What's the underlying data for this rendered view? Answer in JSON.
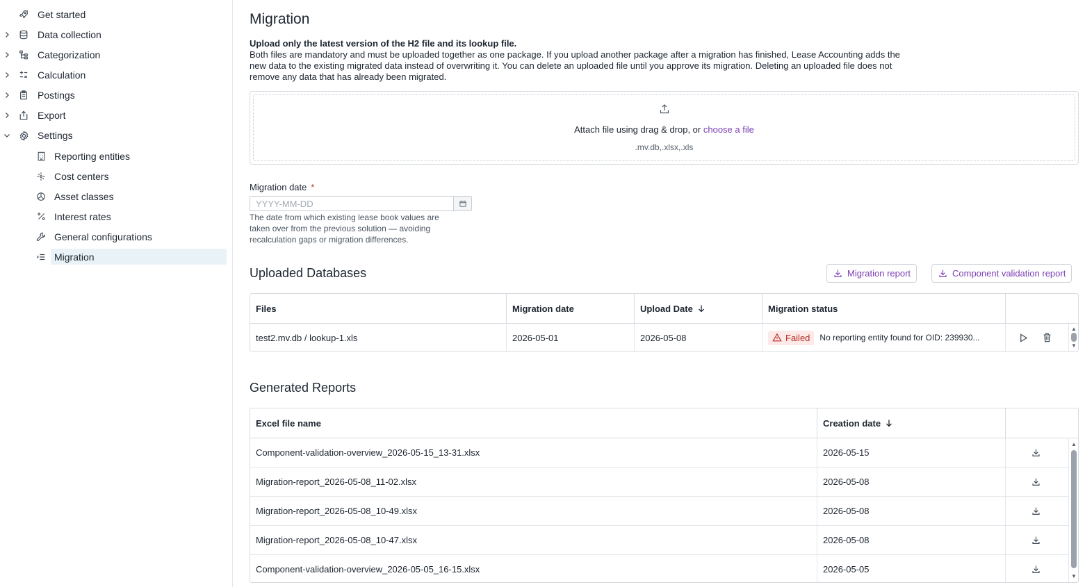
{
  "sidebar": {
    "items": [
      {
        "label": "Get started",
        "icon": "rocket-icon",
        "expandable": false
      },
      {
        "label": "Data collection",
        "icon": "database-icon",
        "expandable": true
      },
      {
        "label": "Categorization",
        "icon": "hierarchy-icon",
        "expandable": true
      },
      {
        "label": "Calculation",
        "icon": "calculator-icon",
        "expandable": true
      },
      {
        "label": "Postings",
        "icon": "clipboard-icon",
        "expandable": true
      },
      {
        "label": "Export",
        "icon": "export-icon",
        "expandable": true
      },
      {
        "label": "Settings",
        "icon": "gear-icon",
        "expandable": true,
        "expanded": true
      }
    ],
    "settings_children": [
      {
        "label": "Reporting entities",
        "icon": "building-icon"
      },
      {
        "label": "Cost centers",
        "icon": "cost-center-icon"
      },
      {
        "label": "Asset classes",
        "icon": "pie-chart-icon"
      },
      {
        "label": "Interest rates",
        "icon": "percent-icon"
      },
      {
        "label": "General configurations",
        "icon": "wrench-icon"
      },
      {
        "label": "Migration",
        "icon": "list-indent-icon",
        "active": true
      }
    ]
  },
  "page": {
    "title": "Migration",
    "intro_bold": "Upload only the latest version of the H2 file and its lookup file.",
    "intro_text": "Both files are mandatory and must be uploaded together as one package. If you upload another package after a migration has finished, Lease Accounting adds the new data to the existing migrated data instead of overwriting it. You can delete an uploaded file until you approve its migration. Deleting an uploaded file does not remove any data that has already been migrated."
  },
  "dropzone": {
    "text": "Attach file using drag & drop, or ",
    "link": "choose a file",
    "types": ".mv.db,.xlsx,.xls"
  },
  "migration_date": {
    "label": "Migration date",
    "required_mark": "*",
    "value": "",
    "placeholder": "YYYY-MM-DD",
    "hint": "The date from which existing lease book values are taken over from the previous solution — avoiding recalculation gaps or migration differences."
  },
  "uploaded": {
    "title": "Uploaded Databases",
    "migration_report_btn": "Migration report",
    "component_report_btn": "Component validation report",
    "columns": [
      "Files",
      "Migration date",
      "Upload Date",
      "Migration status"
    ],
    "rows": [
      {
        "files": "test2.mv.db / lookup-1.xls",
        "migration_date": "2026-05-01",
        "upload_date": "2026-05-08",
        "status": "Failed",
        "message": "No reporting entity found for OID: 239930..."
      }
    ]
  },
  "reports": {
    "title": "Generated Reports",
    "columns": [
      "Excel file name",
      "Creation date"
    ],
    "rows": [
      {
        "name": "Component-validation-overview_2026-05-15_13-31.xlsx",
        "date": "2026-05-15"
      },
      {
        "name": "Migration-report_2026-05-08_11-02.xlsx",
        "date": "2026-05-08"
      },
      {
        "name": "Migration-report_2026-05-08_10-49.xlsx",
        "date": "2026-05-08"
      },
      {
        "name": "Migration-report_2026-05-08_10-47.xlsx",
        "date": "2026-05-08"
      },
      {
        "name": "Component-validation-overview_2026-05-05_16-15.xlsx",
        "date": "2026-05-05"
      }
    ]
  },
  "colors": {
    "accent": "#7b3fb3",
    "failed_bg": "#fde9e8",
    "failed_text": "#b42b22",
    "active_nav": "#e9f2f7"
  }
}
